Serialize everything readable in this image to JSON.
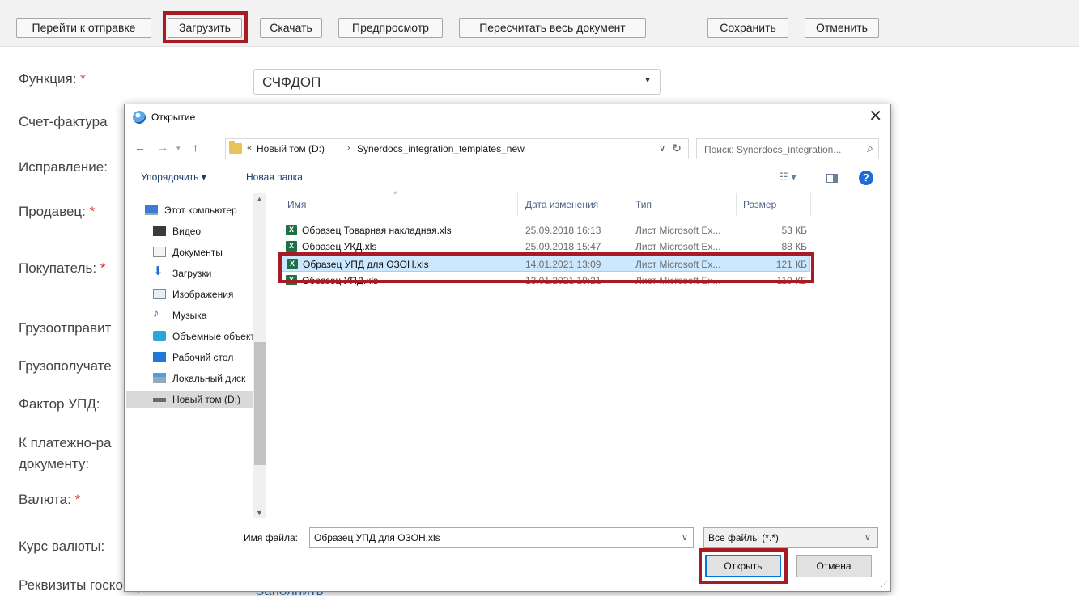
{
  "toolbar": {
    "buttons": [
      "Перейти к отправке",
      "Загрузить",
      "Скачать",
      "Предпросмотр",
      "Пересчитать весь документ",
      "Сохранить",
      "Отменить"
    ]
  },
  "form": {
    "labels": [
      "Функция:",
      "Счет-фактура",
      "Исправление:",
      "Продавец:",
      "Покупатель:",
      "Грузоотправит",
      "Грузополучате",
      "Фактор УПД:",
      "К платежно-ра",
      "документу:",
      "Валюта:",
      "Курс валюты:",
      "Реквизиты госконтракта:"
    ],
    "required_mark": "*",
    "function_value": "СЧФДОП",
    "fill_link": "Заполнить"
  },
  "dialog": {
    "title": "Открытие",
    "close": "✕",
    "address": {
      "prefix": "«",
      "crumbs": [
        "Новый том (D:)",
        "Synerdocs_integration_templates_new"
      ],
      "separator": "›"
    },
    "search_placeholder": "Поиск: Synerdocs_integration...",
    "commands": {
      "organize": "Упорядочить ▾",
      "new_folder": "Новая папка"
    },
    "help": "?",
    "tree": [
      {
        "label": "Этот компьютер",
        "icon": "computer-icon"
      },
      {
        "label": "Видео",
        "icon": "video-icon"
      },
      {
        "label": "Документы",
        "icon": "documents-icon"
      },
      {
        "label": "Загрузки",
        "icon": "downloads-icon"
      },
      {
        "label": "Изображения",
        "icon": "images-icon"
      },
      {
        "label": "Музыка",
        "icon": "music-icon"
      },
      {
        "label": "Объемные объекты",
        "icon": "3d-objects-icon"
      },
      {
        "label": "Рабочий стол",
        "icon": "desktop-icon"
      },
      {
        "label": "Локальный диск",
        "icon": "local-disk-icon"
      },
      {
        "label": "Новый том (D:)",
        "icon": "drive-icon"
      }
    ],
    "columns": [
      "Имя",
      "Дата изменения",
      "Тип",
      "Размер"
    ],
    "files": [
      {
        "name": "Образец Товарная накладная.xls",
        "date": "25.09.2018 16:13",
        "type": "Лист Microsoft Ex...",
        "size": "53 КБ"
      },
      {
        "name": "Образец УКД.xls",
        "date": "25.09.2018 15:47",
        "type": "Лист Microsoft Ex...",
        "size": "88 КБ"
      },
      {
        "name": "Образец УПД для ОЗОН.xls",
        "date": "14.01.2021 13:09",
        "type": "Лист Microsoft Ex...",
        "size": "121 КБ"
      },
      {
        "name": "Образец УПД.xls",
        "date": "13.01.2021 19:21",
        "type": "Лист Microsoft Ex...",
        "size": "119 КБ"
      }
    ],
    "filename_label": "Имя файла:",
    "filename_value": "Образец УПД для ОЗОН.xls",
    "filetype_value": "Все файлы (*.*)",
    "open_label": "Открыть",
    "cancel_label": "Отмена"
  },
  "colors": {
    "highlight": "#a61b24",
    "selection": "#cce8ff",
    "required": "#d9343a"
  }
}
